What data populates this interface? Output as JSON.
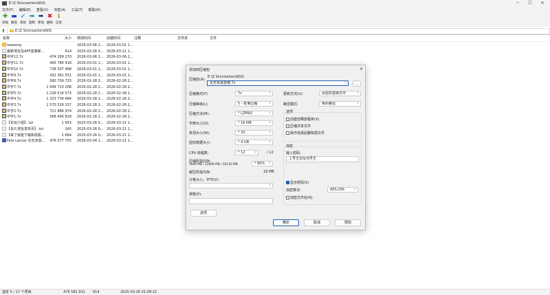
{
  "window": {
    "title": "E:\\Z Sinicization\\ASS\\",
    "controls": [
      "minimize",
      "maximize",
      "close"
    ]
  },
  "menu": [
    "文件(F)",
    "编辑(E)",
    "查看(V)",
    "书签(A)",
    "工具(T)",
    "帮助(H)"
  ],
  "toolbar": [
    {
      "label": "添加",
      "icon": "plus-icon",
      "color": "#2aa52a",
      "glyph": "✚"
    },
    {
      "label": "解压",
      "icon": "minus-icon",
      "color": "#2040c0",
      "glyph": "▬"
    },
    {
      "label": "测试",
      "icon": "check-icon",
      "color": "#2ab0c0",
      "glyph": "✔"
    },
    {
      "label": "复制",
      "icon": "arrow-right-icon",
      "color": "#1a9a8a",
      "glyph": "➡"
    },
    {
      "label": "移动",
      "icon": "arrow-right-icon",
      "color": "#1a2a8a",
      "glyph": "➡"
    },
    {
      "label": "删除",
      "icon": "x-icon",
      "color": "#d02020",
      "glyph": "✖"
    },
    {
      "label": "信息",
      "icon": "info-icon",
      "color": "#a09020",
      "glyph": "ℹ"
    }
  ],
  "address": "E:\\Z Sinicization\\ASS\\",
  "columns": [
    "名称",
    "大小",
    "修改时间",
    "创建时间",
    "注释",
    "文件夹",
    "文件"
  ],
  "files": [
    {
      "name": "laowang",
      "size": "",
      "modified": "2026-03-06 2...",
      "created": "2026-03-01 1...",
      "type": "folder"
    },
    {
      "name": "最新地址及APP蓝奏邮...",
      "size": "614",
      "modified": "2025-03-26 0...",
      "created": "2026-03-21 1...",
      "type": "txt"
    },
    {
      "name": "中字12.7z",
      "size": "474 299 270",
      "modified": "2026-03-06 2...",
      "created": "2026-03-06 2...",
      "type": "7z"
    },
    {
      "name": "中字11.7z",
      "size": "465 784 418",
      "modified": "2026-03-01 1...",
      "created": "2026-03-01 1...",
      "type": "7z"
    },
    {
      "name": "中字10.7z",
      "size": "738 507 488",
      "modified": "2026-03-01 1...",
      "created": "2026-03-01 1...",
      "type": "7z"
    },
    {
      "name": "中字9.7z",
      "size": "432 381 551",
      "modified": "2026-03-01 1...",
      "created": "2026-03-01 1...",
      "type": "7z"
    },
    {
      "name": "中字8.7z",
      "size": "580 709 725",
      "modified": "2026-02-28 2...",
      "created": "2026-02-28 2...",
      "type": "7z"
    },
    {
      "name": "中字7.7z",
      "size": "1 949 723 208",
      "modified": "2026-02-28 2...",
      "created": "2026-02-28 2...",
      "type": "7z"
    },
    {
      "name": "中字5.7z",
      "size": "1 226 514 573",
      "modified": "2026-02-28 2...",
      "created": "2026-02-28 2...",
      "type": "7z"
    },
    {
      "name": "中字4.7z",
      "size": "1 323 734 684",
      "modified": "2026-02-28 2...",
      "created": "2026-02-28 2...",
      "type": "7z"
    },
    {
      "name": "中字3.7z",
      "size": "1 570 326 337",
      "modified": "2026-02-28 2...",
      "created": "2026-02-28 2...",
      "type": "7z"
    },
    {
      "name": "中字2.7z",
      "size": "721 886 974",
      "modified": "2026-02-28 2...",
      "created": "2026-02-28 2...",
      "type": "7z"
    },
    {
      "name": "中字1.7z",
      "size": "568 406 818",
      "modified": "2026-02-28 2...",
      "created": "2026-02-28 2...",
      "type": "7z"
    },
    {
      "name": "【论坛介绍】.txt",
      "size": "1 653",
      "modified": "2025-03-26 0...",
      "created": "2026-03-21 1...",
      "type": "txt"
    },
    {
      "name": "【永久地址发布页】.txt",
      "size": "245",
      "modified": "2025-03-26 0...",
      "created": "2026-03-21 1...",
      "type": "txt"
    },
    {
      "name": "【来了就能下载和观看...",
      "size": "1 664",
      "modified": "2025-03-26 0...",
      "created": "2026-03-21 1...",
      "type": "txt"
    },
    {
      "name": "Fate Lancer 论无米恳...",
      "size": "476 577 755",
      "modified": "2026-03-04 1...",
      "created": "2026-03-21 1...",
      "type": "exe"
    }
  ],
  "status": {
    "selection": "选定 5 / 17 个项目",
    "total_size": "476 581 931",
    "selected_size": "614",
    "date": "2025-03-26 01:08:22"
  },
  "dialog": {
    "title": "添加到压缩包",
    "close": "×",
    "archive_label": "压缩包(A):",
    "archive_dir": "E:\\Z Sinicization\\ASS\\",
    "archive_name": "论无米恳苗德.7z",
    "browse": "...",
    "format_label": "压缩格式(F):",
    "format": "7z",
    "level_label": "压缩等级(L):",
    "level": "5 - 标准压缩",
    "method_label": "压缩方法(M):",
    "method": "* LZMA2",
    "dict_label": "字典大小(D):",
    "dict": "* 16 MB",
    "word_label": "单词大小(W):",
    "word": "* 32",
    "solid_label": "固实数据大小:",
    "solid": "* 4 GB",
    "cpu_label": "CPU 线程数:",
    "cpu": "* 12",
    "cpu_max": "/ 12",
    "mem_label": "压缩所需内存:",
    "mem_detail": "1840 MB / 12896 MB / 16120 MB",
    "mem_pct": "* 80%",
    "decomp_label": "解压所需内存:",
    "decomp": "18 MB",
    "split_label": "分卷大小，字节(V):",
    "split": "",
    "params_label": "参数(P):",
    "params": "",
    "options_btn": "选项",
    "update_label": "更新方式(U):",
    "update": "添加并替换文件",
    "path_label": "路径模式:",
    "path": "相对路径",
    "options_group": "选项",
    "opt_sfx": "创建自释放程序(X)",
    "opt_shared": "压缩共享文件",
    "opt_delete": "操作完成后删除源文件",
    "enc_group": "加密",
    "pwd_label": "输入密码:",
    "password": "上号王论坛当号王",
    "show_pwd": "显示密码(S)",
    "enc_method_label": "加密算法:",
    "enc_method": "AES-256",
    "enc_names": "加密文件名(N)",
    "ok": "确定",
    "cancel": "取消",
    "help": "帮助"
  }
}
